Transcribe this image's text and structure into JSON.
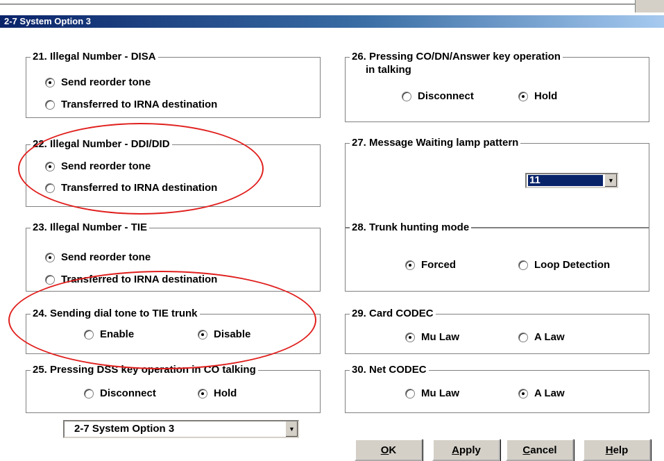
{
  "window": {
    "title": "2-7 System Option 3"
  },
  "groups": {
    "g21": {
      "title": "21. Illegal Number - DISA",
      "options": [
        "Send reorder tone",
        "Transferred to IRNA destination"
      ],
      "selected": 0
    },
    "g22": {
      "title": "22. Illegal Number - DDI/DID",
      "options": [
        "Send reorder tone",
        "Transferred to IRNA destination"
      ],
      "selected": 0
    },
    "g23": {
      "title": "23. Illegal Number - TIE",
      "options": [
        "Send reorder tone",
        "Transferred to IRNA destination"
      ],
      "selected": 0
    },
    "g24": {
      "title": "24. Sending dial tone to TIE trunk",
      "options": [
        "Enable",
        "Disable"
      ],
      "selected": 1
    },
    "g25": {
      "title": "25. Pressing DSS key operation in CO talking",
      "options": [
        "Disconnect",
        "Hold"
      ],
      "selected": 1
    },
    "g26": {
      "title_line1": "26. Pressing CO/DN/Answer key operation",
      "title_line2": "in talking",
      "options": [
        "Disconnect",
        "Hold"
      ],
      "selected": 1
    },
    "g27": {
      "title": "27. Message Waiting lamp pattern",
      "value": "11"
    },
    "g28": {
      "title": "28. Trunk hunting mode",
      "options": [
        "Forced",
        "Loop Detection"
      ],
      "selected": 0
    },
    "g29": {
      "title": "29. Card CODEC",
      "options": [
        "Mu Law",
        "A Law"
      ],
      "selected": 0
    },
    "g30": {
      "title": "30. Net CODEC",
      "options": [
        "Mu Law",
        "A Law"
      ],
      "selected": 1
    }
  },
  "footer": {
    "page_select": "2-7 System Option 3",
    "ok": {
      "mnemonic": "O",
      "rest": "K"
    },
    "apply": {
      "mnemonic": "A",
      "rest": "pply"
    },
    "cancel": {
      "mnemonic": "C",
      "rest": "ancel"
    },
    "help": {
      "mnemonic": "H",
      "rest": "elp"
    }
  },
  "annotation_color": "#e0201e"
}
